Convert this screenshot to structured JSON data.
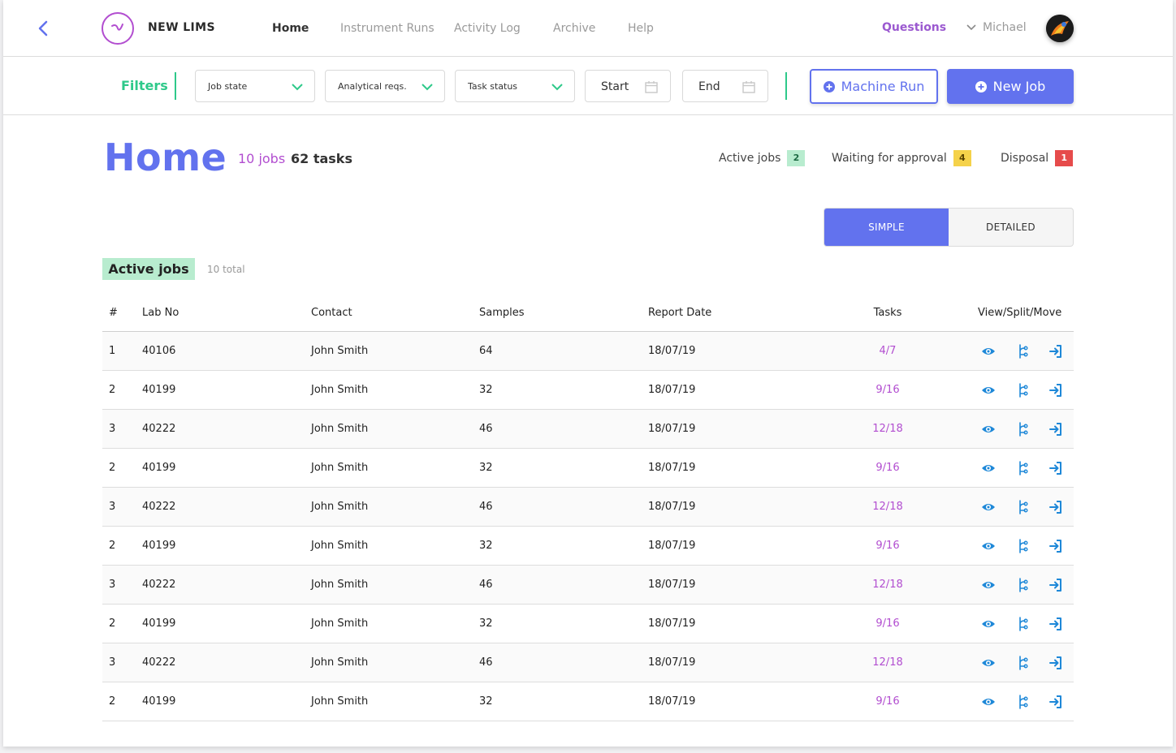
{
  "app": {
    "name": "NEW LIMS",
    "brand_color": "#b24ed0",
    "accent_color": "#6272ee",
    "filter_color": "#2ec98a"
  },
  "nav": {
    "links": [
      {
        "label": "Home",
        "active": true
      },
      {
        "label": "Instrument Runs",
        "active": false
      },
      {
        "label": "Activity Log",
        "active": false
      },
      {
        "label": "Archive",
        "active": false
      },
      {
        "label": "Help",
        "active": false
      }
    ],
    "questions_label": "Questions",
    "user_name": "Michael"
  },
  "filters": {
    "label": "Filters",
    "job_state": "Job state",
    "analytical_reqs": "Analytical reqs.",
    "task_status": "Task status",
    "start_label": "Start",
    "end_label": "End",
    "machine_run_label": "Machine Run",
    "new_job_label": "New Job"
  },
  "header": {
    "title": "Home",
    "jobs_count": "10 jobs",
    "tasks_count": "62 tasks",
    "statuses": [
      {
        "label": "Active jobs",
        "count": "2",
        "bg": "#b8eccf",
        "fg": "#1e6b44"
      },
      {
        "label": "Waiting for approval",
        "count": "4",
        "bg": "#f5d24a",
        "fg": "#5a4400"
      },
      {
        "label": "Disposal",
        "count": "1",
        "bg": "#e64b4b",
        "fg": "#ffffff"
      }
    ]
  },
  "view_toggle": {
    "simple": "SIMPLE",
    "detailed": "DETAILED",
    "selected": "simple"
  },
  "section": {
    "title": "Active jobs",
    "total": "10 total"
  },
  "table": {
    "columns": [
      "#",
      "Lab No",
      "Contact",
      "Samples",
      "Report Date",
      "Tasks",
      "View/Split/Move"
    ],
    "rows": [
      {
        "num": "1",
        "lab": "40106",
        "contact": "John Smith",
        "samples": "64",
        "date": "18/07/19",
        "tasks": "4/7"
      },
      {
        "num": "2",
        "lab": "40199",
        "contact": "John Smith",
        "samples": "32",
        "date": "18/07/19",
        "tasks": "9/16"
      },
      {
        "num": "3",
        "lab": "40222",
        "contact": "John Smith",
        "samples": "46",
        "date": "18/07/19",
        "tasks": "12/18"
      },
      {
        "num": "2",
        "lab": "40199",
        "contact": "John Smith",
        "samples": "32",
        "date": "18/07/19",
        "tasks": "9/16"
      },
      {
        "num": "3",
        "lab": "40222",
        "contact": "John Smith",
        "samples": "46",
        "date": "18/07/19",
        "tasks": "12/18"
      },
      {
        "num": "2",
        "lab": "40199",
        "contact": "John Smith",
        "samples": "32",
        "date": "18/07/19",
        "tasks": "9/16"
      },
      {
        "num": "3",
        "lab": "40222",
        "contact": "John Smith",
        "samples": "46",
        "date": "18/07/19",
        "tasks": "12/18"
      },
      {
        "num": "2",
        "lab": "40199",
        "contact": "John Smith",
        "samples": "32",
        "date": "18/07/19",
        "tasks": "9/16"
      },
      {
        "num": "3",
        "lab": "40222",
        "contact": "John Smith",
        "samples": "46",
        "date": "18/07/19",
        "tasks": "12/18"
      },
      {
        "num": "2",
        "lab": "40199",
        "contact": "John Smith",
        "samples": "32",
        "date": "18/07/19",
        "tasks": "9/16"
      }
    ],
    "action_icons": [
      "eye-icon",
      "split-icon",
      "move-icon"
    ],
    "action_color": "#1e88d8"
  }
}
